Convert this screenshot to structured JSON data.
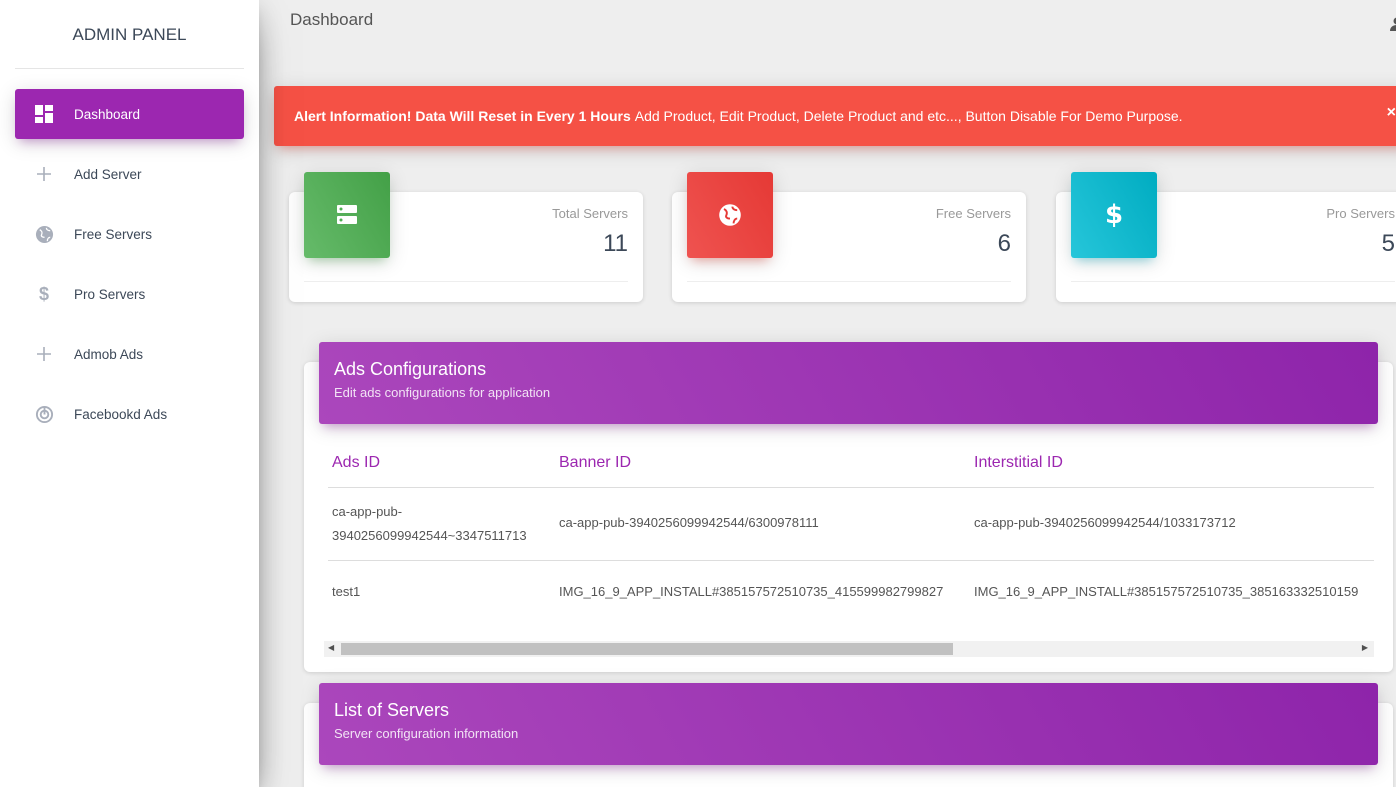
{
  "sidebar": {
    "brand": "ADMIN PANEL",
    "items": [
      {
        "label": "Dashboard",
        "icon": "dashboard-icon",
        "active": true
      },
      {
        "label": "Add Server",
        "icon": "plus-icon"
      },
      {
        "label": "Free Servers",
        "icon": "globe-icon"
      },
      {
        "label": "Pro Servers",
        "icon": "dollar-icon"
      },
      {
        "label": "Admob Ads",
        "icon": "plus-icon"
      },
      {
        "label": "Facebookd Ads",
        "icon": "track-icon"
      }
    ]
  },
  "header": {
    "title": "Dashboard",
    "user_icon": "person-icon"
  },
  "alert": {
    "bold_text": "Alert Information! Data Will Reset in Every 1 Hours",
    "text": "Add Product, Edit Product, Delete Product and etc..., Button Disable For Demo Purpose.",
    "close_label": "×",
    "color": "#f55145"
  },
  "stats": [
    {
      "label": "Total Servers",
      "value": "11",
      "icon": "storage-icon",
      "color": "#4caf50"
    },
    {
      "label": "Free Servers",
      "value": "6",
      "icon": "globe-icon",
      "color": "#f44336"
    },
    {
      "label": "Pro Servers",
      "value": "5",
      "icon": "dollar-icon",
      "color": "#00bcd4"
    }
  ],
  "ads_card": {
    "title": "Ads Configurations",
    "subtitle": "Edit ads configurations for application",
    "columns": [
      "Ads ID",
      "Banner ID",
      "Interstitial ID"
    ],
    "rows": [
      {
        "ads_id_line1": "ca-app-pub-",
        "ads_id_line2": "3940256099942544~3347511713",
        "banner_id": "ca-app-pub-3940256099942544/6300978111",
        "interstitial_id": "ca-app-pub-3940256099942544/1033173712"
      },
      {
        "ads_id_line1": "test1",
        "ads_id_line2": "",
        "banner_id": "IMG_16_9_APP_INSTALL#385157572510735_415599982799827",
        "interstitial_id": "IMG_16_9_APP_INSTALL#385157572510735_385163332510159"
      }
    ]
  },
  "servers_card": {
    "title": "List of Servers",
    "subtitle": "Server configuration information"
  },
  "theme": {
    "accent": "#9c27b0"
  }
}
